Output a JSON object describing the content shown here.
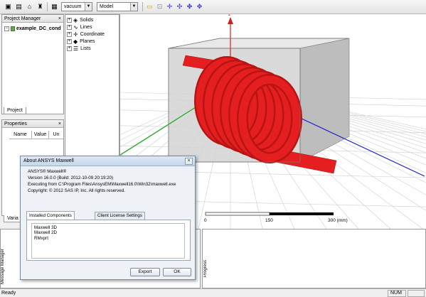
{
  "toolbar": {
    "material_value": "vacuum",
    "coordinate_system_value": "Model"
  },
  "project_manager": {
    "title": "Project Manager",
    "project_name": "example_DC_cond",
    "tab_label": "Project"
  },
  "model_tree": {
    "items": [
      "Solids",
      "Lines",
      "Coordinate",
      "Planes",
      "Lists"
    ]
  },
  "properties": {
    "title": "Properties",
    "columns": [
      "Name",
      "Value",
      "Un"
    ],
    "variables_tab_label": "Varia"
  },
  "ruler": {
    "ticks": [
      "0",
      "150",
      "300 (mm)"
    ]
  },
  "message_manager": {
    "label": "Message Manager"
  },
  "progress": {
    "label": "Progress"
  },
  "statusbar": {
    "text": "Ready",
    "num_label": "NUM"
  },
  "dialog": {
    "title": "About ANSYS Maxwell",
    "lines": [
      "ANSYS® Maxwell®",
      "Version 16.0.0  (Build: 2012-10-09 20:19:20)",
      "Executing from C:\\Program Files\\AnsysEM\\Maxwell16.0\\Win32\\maxwell.exe",
      "Copyright: © 2012 SAS IP, Inc. All rights reserved."
    ],
    "tabs": [
      "Installed Components",
      "Client License Settings"
    ],
    "components": [
      "Maxwell 3D",
      "Maxwell 2D",
      "RMxprt"
    ],
    "export_label": "Export",
    "ok_label": "OK"
  },
  "colors": {
    "coil": "#e51f1f",
    "box_fill": "#cfcfcf",
    "grid": "#c8c8c8",
    "z_axis": "#d02020",
    "x_axis": "#1a1ad0",
    "y_axis": "#22aa22",
    "dialog_title_bg": "#c5d8ee"
  }
}
